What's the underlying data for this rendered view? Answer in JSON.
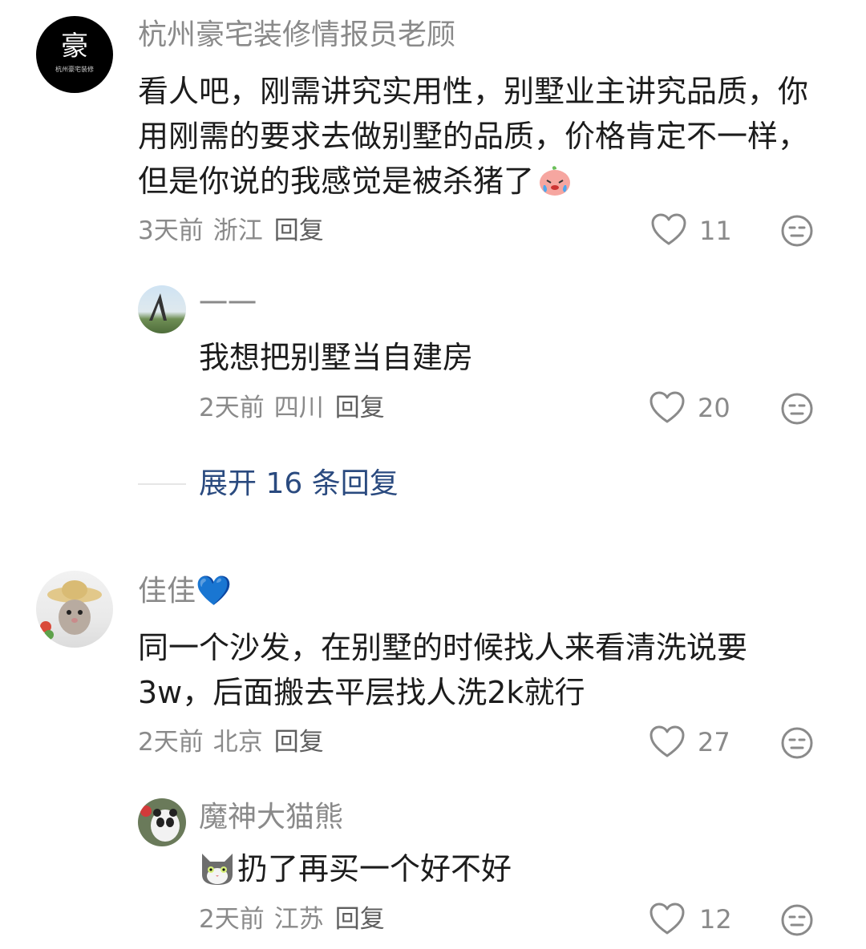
{
  "comments": [
    {
      "avatar_text": "豪",
      "avatar_subtext": "杭州豪宅装修",
      "author": "杭州豪宅装修情报员老顾",
      "content": "看人吧，刚需讲究实用性，别墅业主讲究品质，你用刚需的要求去做别墅的品质，价格肯定不一样，但是你说的我感觉是被杀猪了",
      "emoji": "crying-peach-emoji",
      "time": "3天前",
      "location": "浙江",
      "reply_label": "回复",
      "likes": "11",
      "replies": [
        {
          "author": "一一",
          "content": "我想把别墅当自建房",
          "time": "2天前",
          "location": "四川",
          "reply_label": "回复",
          "likes": "20"
        }
      ],
      "expand_label": "展开 16 条回复"
    },
    {
      "author": "佳佳💙",
      "content": "同一个沙发，在别墅的时候找人来看清洗说要3w，后面搬去平层找人洗2k就行",
      "time": "2天前",
      "location": "北京",
      "reply_label": "回复",
      "likes": "27",
      "replies": [
        {
          "author": "魔神大猫熊",
          "content": "扔了再买一个好不好",
          "emoji": "cat-emoji",
          "time": "2天前",
          "location": "江苏",
          "reply_label": "回复",
          "likes": "12"
        }
      ]
    }
  ],
  "colors": {
    "name": "#8a8a8a",
    "text": "#1c1c1c",
    "expand": "#2a4a7f",
    "icon": "#8a8a8a"
  }
}
